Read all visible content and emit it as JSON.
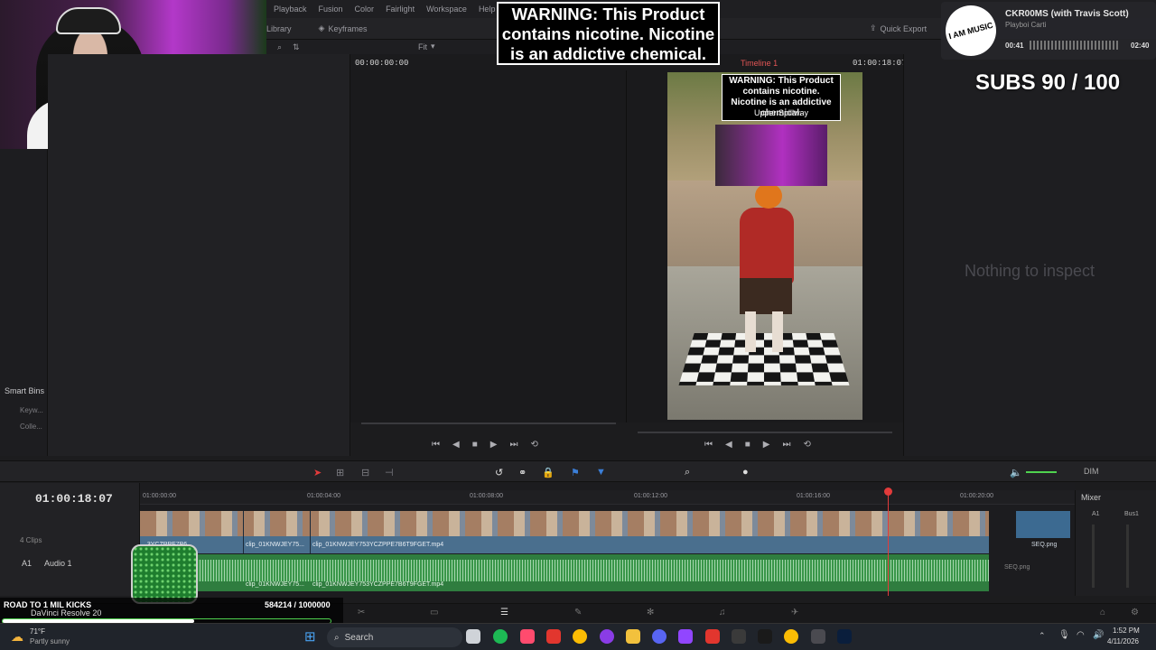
{
  "menu": [
    "Playback",
    "Fusion",
    "Color",
    "Fairlight",
    "Workspace",
    "Help"
  ],
  "toolbar": {
    "library": "Library",
    "keyframes": "Keyframes",
    "quick_export": "Quick Export",
    "fit": "Fit"
  },
  "source_viewer": {
    "timecode": "00:00:00:00"
  },
  "program_viewer": {
    "timeline_name": "Timeline 1",
    "timecode": "01:00:18:07"
  },
  "video_overlay": {
    "warning": "WARNING: This Product contains nicotine. Nicotine is an addictive chemical.",
    "location": "Upper Spillway"
  },
  "warning_overlay": {
    "text": "WARNING: This Product contains nicotine. Nicotine is an addictive chemical."
  },
  "music": {
    "title": "CKR00MS (with Travis Scott)",
    "artist": "Playboi Carti",
    "elapsed": "00:41",
    "total": "02:40",
    "art_text": "I AM MUSIC"
  },
  "subs": {
    "text": "SUBS 90 / 100"
  },
  "inspector": {
    "empty_text": "Nothing to inspect"
  },
  "smart_bins": {
    "title": "Smart Bins",
    "items": [
      "Keyw...",
      "Colle..."
    ]
  },
  "timeline": {
    "timecode": "01:00:18:07",
    "ruler": [
      "01:00:00:00",
      "01:00:04:00",
      "01:00:08:00",
      "01:00:12:00",
      "01:00:16:00",
      "01:00:20:00"
    ],
    "video_track": {
      "clips_count": "4 Clips"
    },
    "audio_track": {
      "id": "A1",
      "name": "Audio 1"
    },
    "clips": [
      "...3YCZPPE7B6...",
      "clip_01KNWJEY75...",
      "clip_01KNWJEY753YCZPPE7B6T9FGET.mp4"
    ],
    "seq_clip": "SEQ.png",
    "dim_label": "DIM"
  },
  "mixer": {
    "title": "Mixer",
    "channels": [
      "A1",
      "Bus1"
    ]
  },
  "road": {
    "title": "ROAD TO 1 MIL KICKS",
    "count": "584214 / 1000000",
    "progress": 0.584,
    "app": "DaVinci Resolve 20"
  },
  "taskbar": {
    "temp": "71°F",
    "weather": "Partly sunny",
    "search_placeholder": "Search",
    "time": "1:52 PM",
    "date": "4/11/2026"
  },
  "colors": {
    "accent": "#e23b3b",
    "video_clip": "#4a6f8e",
    "audio_clip": "#2f7d3f"
  }
}
